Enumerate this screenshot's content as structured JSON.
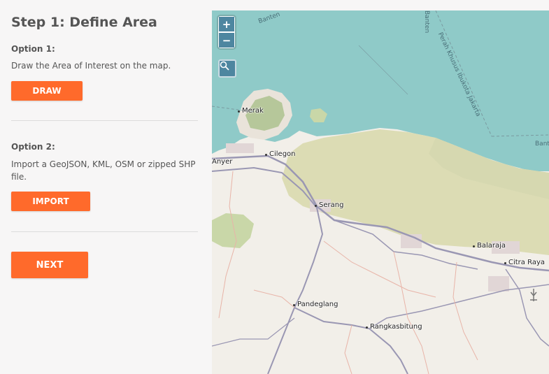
{
  "sidebar": {
    "title": "Step 1: Define Area",
    "option1": {
      "label": "Option 1:",
      "description": "Draw the Area of Interest on the map.",
      "button": "DRAW"
    },
    "option2": {
      "label": "Option 2:",
      "description": "Import a GeoJSON, KML, OSM or zipped SHP file.",
      "button": "IMPORT"
    },
    "next_button": "NEXT"
  },
  "map": {
    "zoom_in": "+",
    "zoom_out": "−",
    "search_icon": "magnifier",
    "places": {
      "merak": "Merak",
      "cilegon": "Cilegon",
      "anyer": "Anyer",
      "serang": "Serang",
      "balaraja": "Balaraja",
      "citra_raya": "Citra Raya",
      "pandeglang": "Pandeglang",
      "rangkasbitung": "Rangkasbitung"
    },
    "sea_labels": {
      "banten_top": "Banten",
      "banten_right": "Banten",
      "jakarta_boundary": "Perah Khusus Ibukota Jakarta",
      "banten_vertical": "Banten"
    },
    "colors": {
      "sea": "#8fcac8",
      "land": "#f2efe9",
      "forest": "#c9d7a8",
      "accent": "#ff6a2b"
    }
  }
}
